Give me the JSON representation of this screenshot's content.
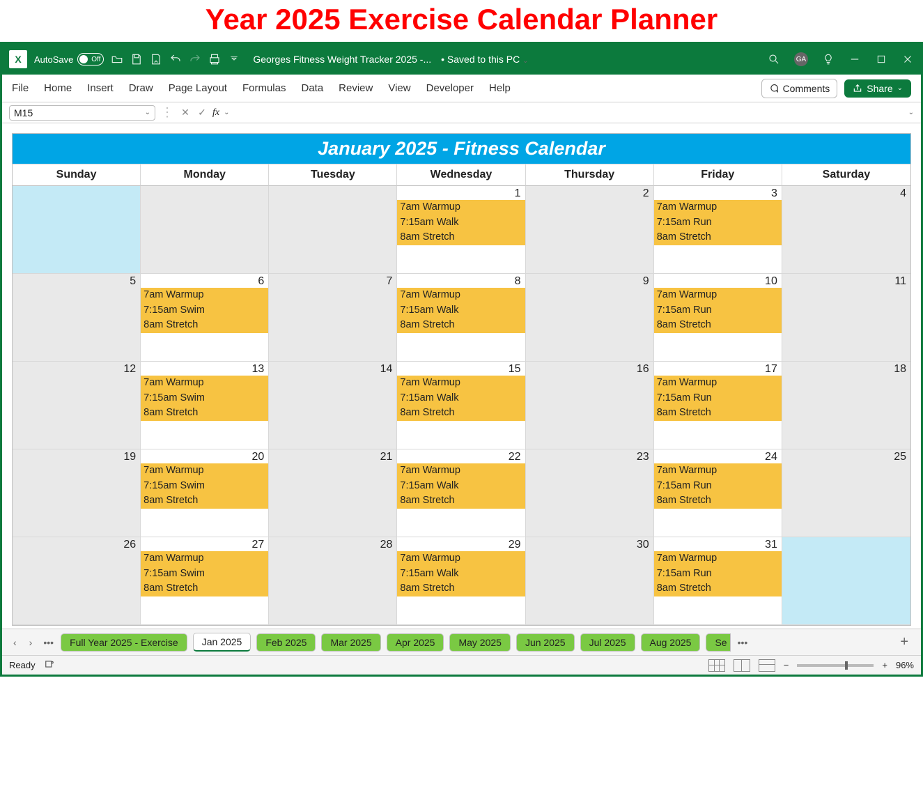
{
  "page_title": "Year 2025 Exercise Calendar Planner",
  "titlebar": {
    "autosave_label": "AutoSave",
    "autosave_state": "Off",
    "filename": "Georges Fitness Weight Tracker 2025 -...",
    "saved_status": "• Saved to this PC",
    "avatar": "GA"
  },
  "ribbon": {
    "tabs": [
      "File",
      "Home",
      "Insert",
      "Draw",
      "Page Layout",
      "Formulas",
      "Data",
      "Review",
      "View",
      "Developer",
      "Help"
    ],
    "comments": "Comments",
    "share": "Share"
  },
  "formula_bar": {
    "cell_ref": "M15",
    "fx": "fx",
    "value": ""
  },
  "calendar": {
    "title": "January 2025  -  Fitness Calendar",
    "days": [
      "Sunday",
      "Monday",
      "Tuesday",
      "Wednesday",
      "Thursday",
      "Friday",
      "Saturday"
    ],
    "workout_mon": [
      "7am Warmup",
      "7:15am Swim",
      "8am Stretch"
    ],
    "workout_wed": [
      "7am Warmup",
      "7:15am Walk",
      "8am Stretch"
    ],
    "workout_fri": [
      "7am Warmup",
      "7:15am Run",
      "8am Stretch"
    ],
    "cells": [
      {
        "num": "",
        "bg": "empty-light"
      },
      {
        "num": "",
        "bg": "shade"
      },
      {
        "num": "",
        "bg": "shade"
      },
      {
        "num": "1",
        "ev": "wed"
      },
      {
        "num": "2",
        "bg": "shade"
      },
      {
        "num": "3",
        "ev": "fri"
      },
      {
        "num": "4",
        "bg": "shade"
      },
      {
        "num": "5",
        "bg": "shade"
      },
      {
        "num": "6",
        "ev": "mon"
      },
      {
        "num": "7",
        "bg": "shade"
      },
      {
        "num": "8",
        "ev": "wed"
      },
      {
        "num": "9",
        "bg": "shade"
      },
      {
        "num": "10",
        "ev": "fri"
      },
      {
        "num": "11",
        "bg": "shade"
      },
      {
        "num": "12",
        "bg": "shade"
      },
      {
        "num": "13",
        "ev": "mon"
      },
      {
        "num": "14",
        "bg": "shade"
      },
      {
        "num": "15",
        "ev": "wed"
      },
      {
        "num": "16",
        "bg": "shade"
      },
      {
        "num": "17",
        "ev": "fri"
      },
      {
        "num": "18",
        "bg": "shade"
      },
      {
        "num": "19",
        "bg": "shade"
      },
      {
        "num": "20",
        "ev": "mon"
      },
      {
        "num": "21",
        "bg": "shade"
      },
      {
        "num": "22",
        "ev": "wed"
      },
      {
        "num": "23",
        "bg": "shade"
      },
      {
        "num": "24",
        "ev": "fri"
      },
      {
        "num": "25",
        "bg": "shade"
      },
      {
        "num": "26",
        "bg": "shade"
      },
      {
        "num": "27",
        "ev": "mon"
      },
      {
        "num": "28",
        "bg": "shade"
      },
      {
        "num": "29",
        "ev": "wed"
      },
      {
        "num": "30",
        "bg": "shade"
      },
      {
        "num": "31",
        "ev": "fri"
      },
      {
        "num": "",
        "bg": "empty-light"
      }
    ]
  },
  "sheet_tabs": {
    "tabs": [
      {
        "label": "Full Year 2025 - Exercise",
        "active": false
      },
      {
        "label": "Jan 2025",
        "active": true
      },
      {
        "label": "Feb 2025",
        "active": false
      },
      {
        "label": "Mar 2025",
        "active": false
      },
      {
        "label": "Apr 2025",
        "active": false
      },
      {
        "label": "May 2025",
        "active": false
      },
      {
        "label": "Jun 2025",
        "active": false
      },
      {
        "label": "Jul 2025",
        "active": false
      },
      {
        "label": "Aug 2025",
        "active": false
      },
      {
        "label": "Se",
        "active": false,
        "clipped": true
      }
    ]
  },
  "statusbar": {
    "ready": "Ready",
    "zoom": "96%"
  }
}
